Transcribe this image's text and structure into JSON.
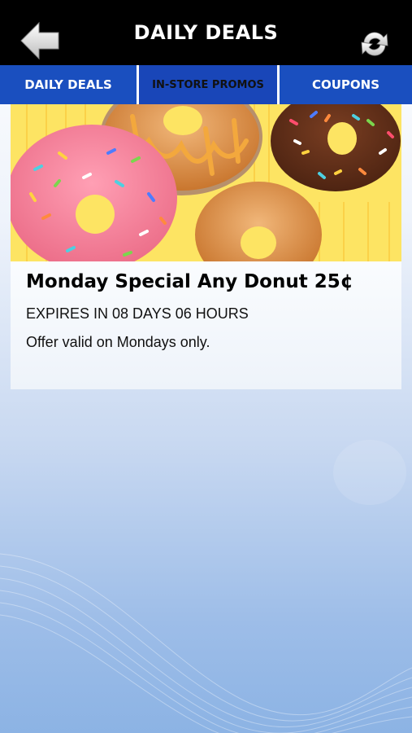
{
  "header": {
    "title": "DAILY DEALS",
    "back_icon": "back-arrow-icon",
    "refresh_icon": "refresh-icon"
  },
  "tabs": [
    {
      "label": "DAILY DEALS",
      "active": true
    },
    {
      "label": "IN-STORE PROMOS",
      "active": false
    },
    {
      "label": "COUPONS",
      "active": false
    }
  ],
  "deal": {
    "title": "Monday Special Any Donut 25¢",
    "expiry": "EXPIRES IN 08 DAYS 06 HOURS",
    "description": "Offer valid on Mondays only."
  },
  "colors": {
    "header_bg": "#000000",
    "tab_bg": "#1a4fbf",
    "image_bg": "#fde463"
  }
}
